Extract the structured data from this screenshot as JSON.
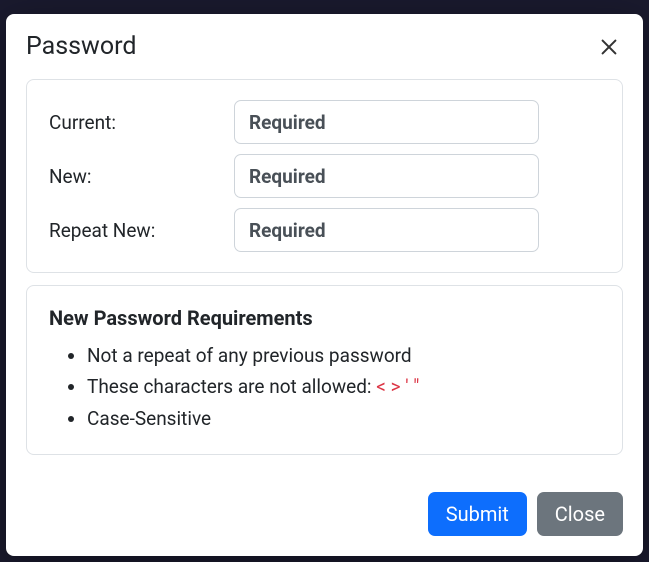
{
  "modal": {
    "title": "Password"
  },
  "form": {
    "current": {
      "label": "Current:",
      "placeholder": "Required"
    },
    "new": {
      "label": "New:",
      "placeholder": "Required"
    },
    "repeat": {
      "label": "Repeat New:",
      "placeholder": "Required"
    }
  },
  "requirements": {
    "title": "New Password Requirements",
    "items": {
      "0": "Not a repeat of any previous password",
      "1_prefix": "These characters are not allowed: ",
      "1_chars": "< > ' \"",
      "2": "Case-Sensitive"
    }
  },
  "footer": {
    "submit": "Submit",
    "close": "Close"
  }
}
